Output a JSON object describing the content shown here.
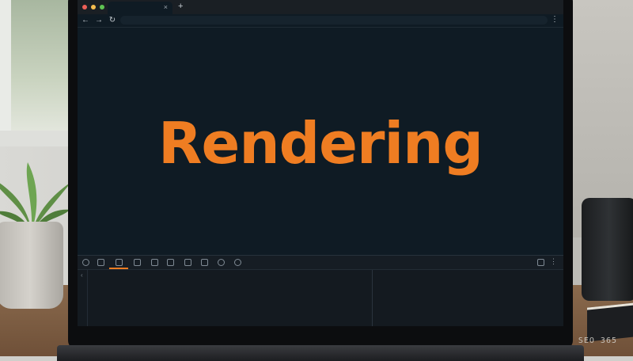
{
  "viewport": {
    "headline": "Rendering"
  },
  "colors": {
    "accent": "#ef7d22",
    "background": "#0f1b24",
    "traffic_red": "#ee5f57",
    "traffic_yellow": "#f5bd4f",
    "traffic_green": "#5fc453"
  },
  "browser": {
    "tab_close": "×",
    "new_tab": "+",
    "menu": "⋮",
    "nav": {
      "back": "←",
      "forward": "→",
      "reload": "↻"
    }
  },
  "devtools": {
    "menu": "⋮",
    "caret": "‹",
    "icons": [
      "inspect-icon",
      "device-icon",
      "elements-icon",
      "console-icon",
      "sources-icon",
      "network-icon",
      "performance-icon",
      "memory-icon",
      "application-icon",
      "settings-icon"
    ]
  },
  "watermark": "SEO 365"
}
